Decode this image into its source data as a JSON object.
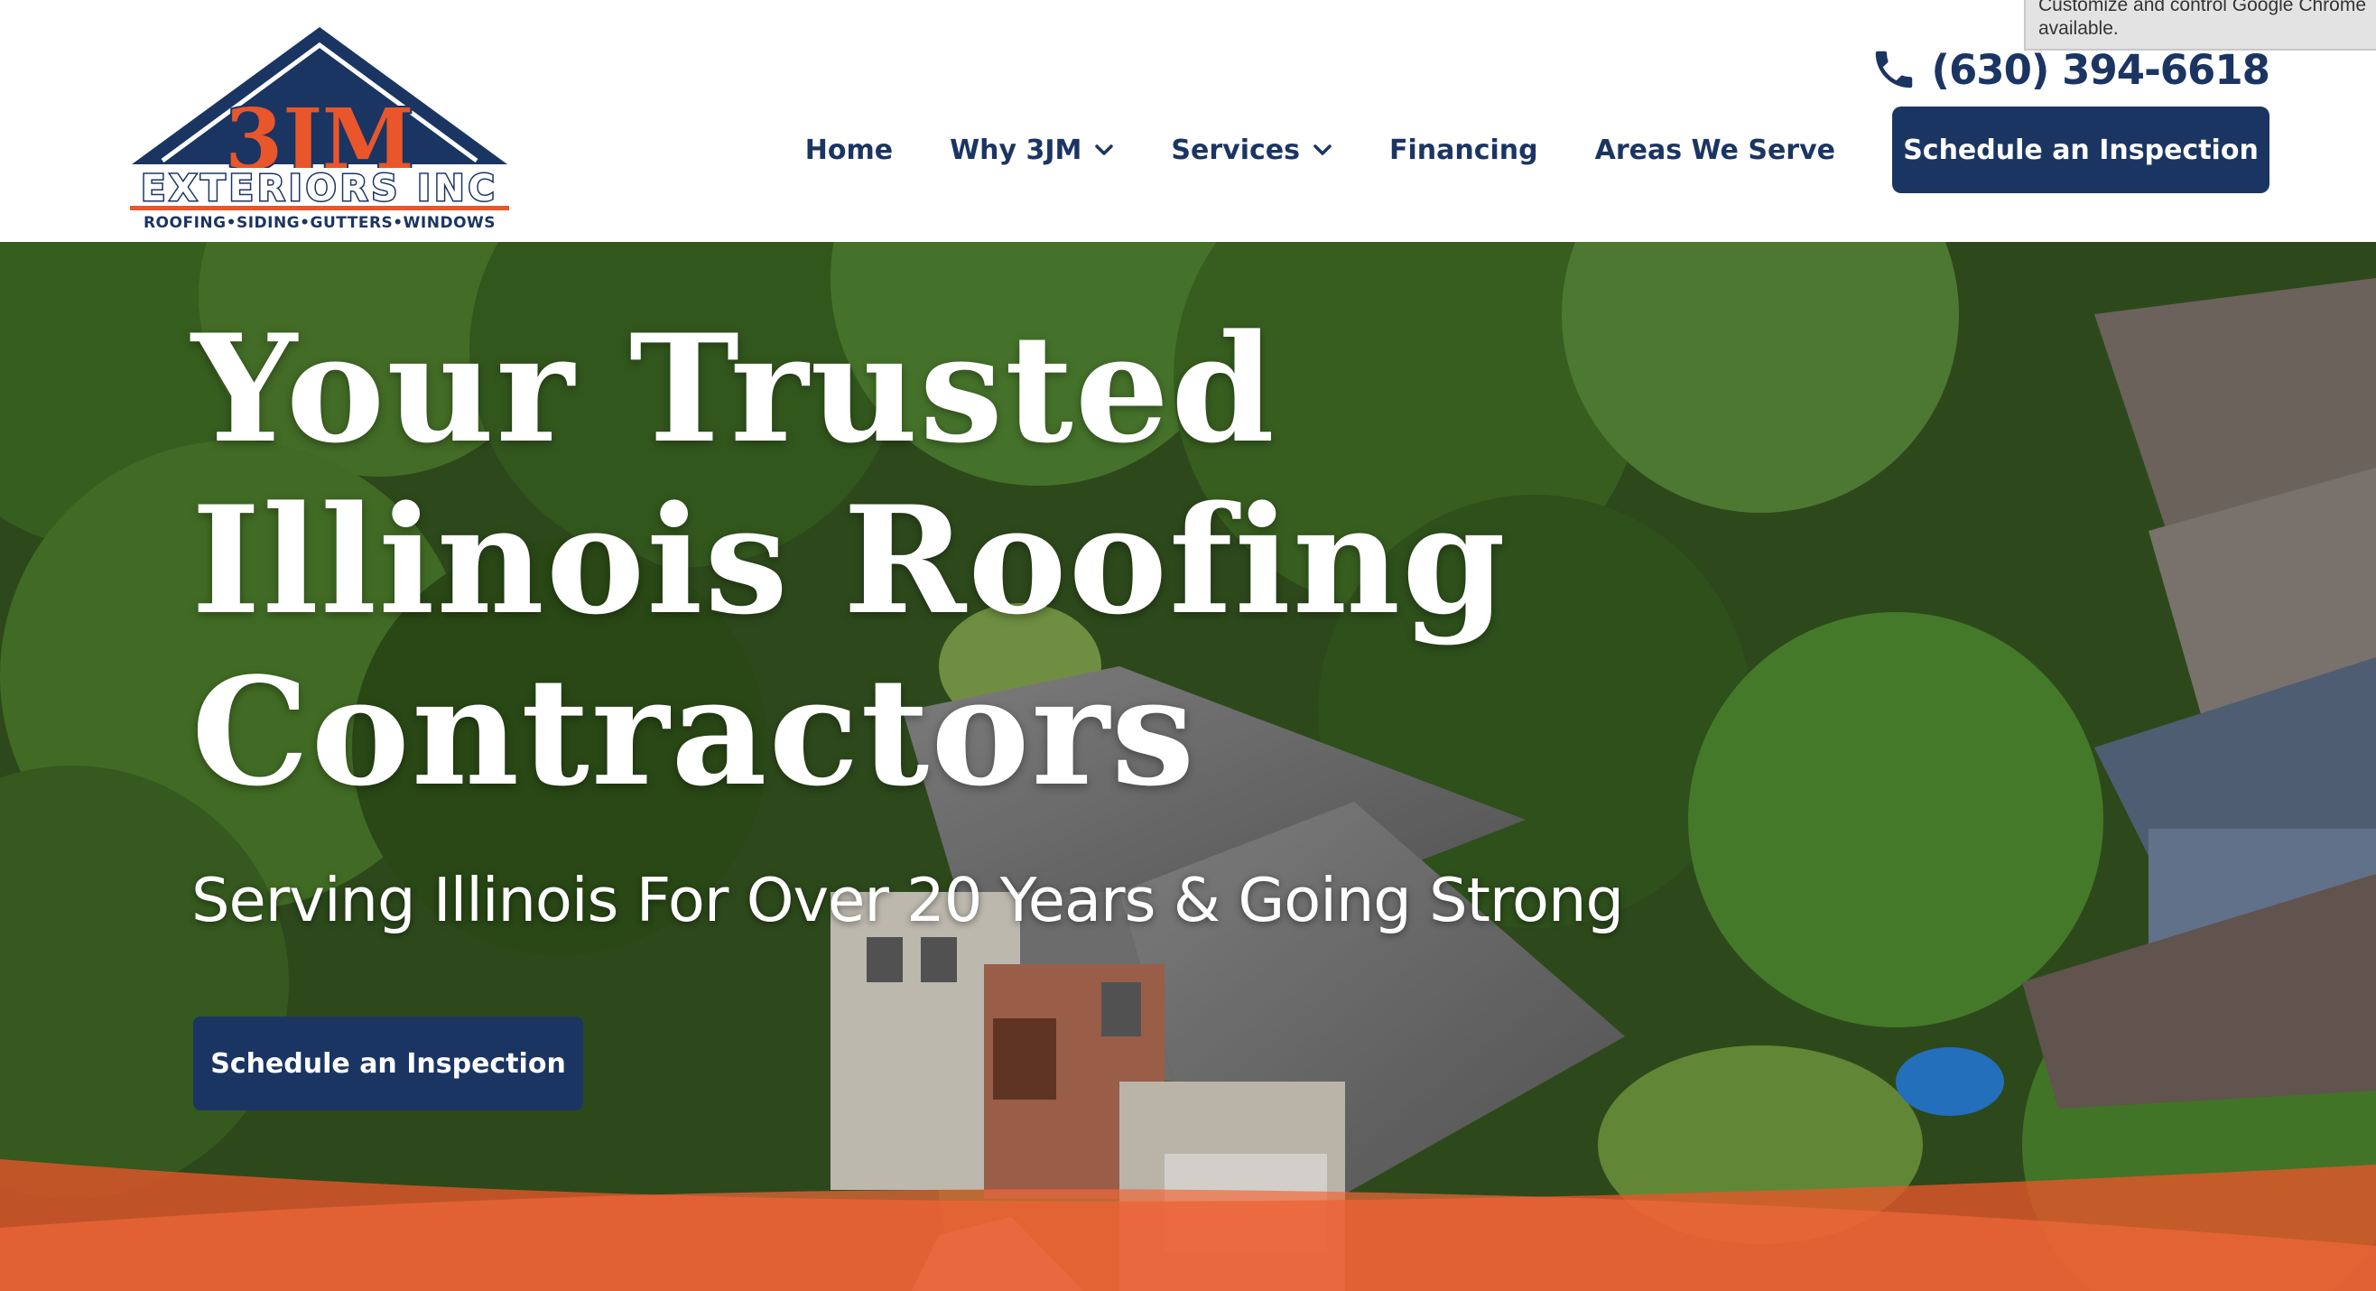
{
  "browser_tooltip": {
    "line1": "Customize and control Google Chrome",
    "line2": "available."
  },
  "header": {
    "logo": {
      "brand": "3JM",
      "name": "EXTERIORS INC",
      "tagline": "ROOFING•SIDING•GUTTERS•WINDOWS"
    },
    "phone": {
      "icon": "phone-icon",
      "number": "(630) 394-6618"
    },
    "nav": {
      "items": [
        {
          "label": "Home",
          "has_dropdown": false
        },
        {
          "label": "Why 3JM",
          "has_dropdown": true
        },
        {
          "label": "Services",
          "has_dropdown": true
        },
        {
          "label": "Financing",
          "has_dropdown": false
        },
        {
          "label": "Areas We Serve",
          "has_dropdown": false
        }
      ],
      "cta_label": "Schedule an Inspection"
    }
  },
  "hero": {
    "title_lines": [
      "Your Trusted",
      "Illinois Roofing",
      "Contractors"
    ],
    "subtitle": "Serving Illinois For Over 20 Years & Going Strong",
    "cta_label": "Schedule an Inspection"
  },
  "colors": {
    "navy": "#1b3563",
    "orange": "#e8562a",
    "white": "#ffffff"
  }
}
